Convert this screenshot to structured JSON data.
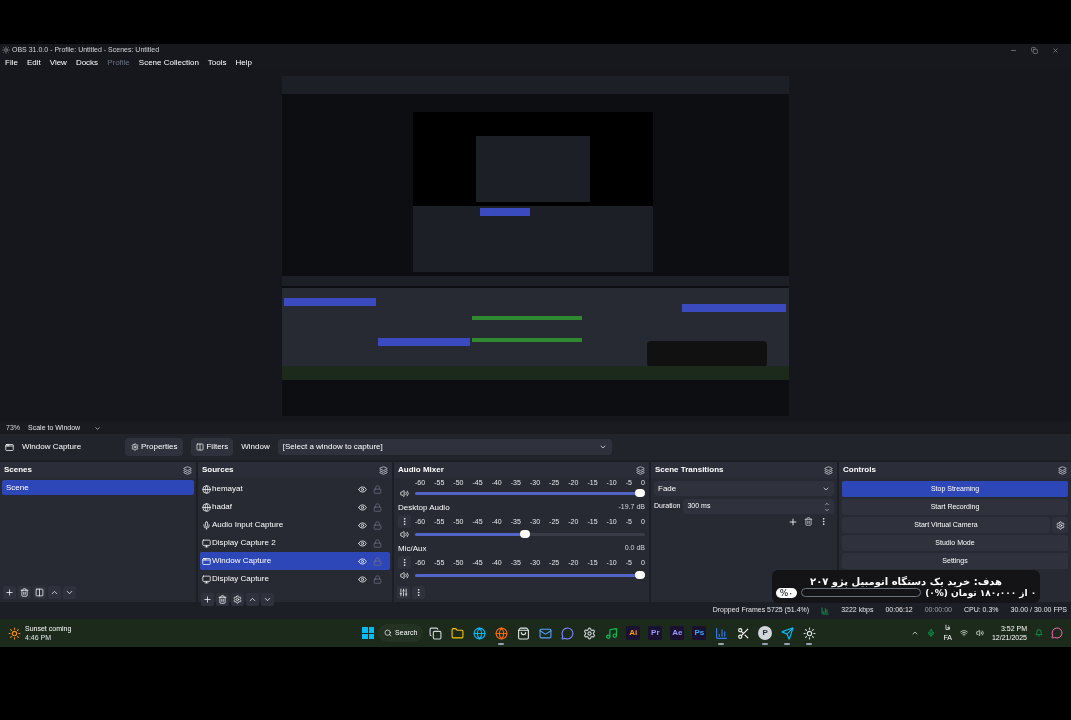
{
  "window": {
    "title": "OBS 31.0.0 - Profile: Untitled - Scenes: Untitled"
  },
  "menu": [
    {
      "label": "File",
      "disabled": false
    },
    {
      "label": "Edit",
      "disabled": false
    },
    {
      "label": "View",
      "disabled": false
    },
    {
      "label": "Docks",
      "disabled": false
    },
    {
      "label": "Profile",
      "disabled": true
    },
    {
      "label": "Scene Collection",
      "disabled": false
    },
    {
      "label": "Tools",
      "disabled": false
    },
    {
      "label": "Help",
      "disabled": false
    }
  ],
  "preview": {
    "zoom": "73%",
    "scale_mode": "Scale to Window"
  },
  "source_toolbar": {
    "source": "Window Capture",
    "properties": "Properties",
    "filters": "Filters",
    "window_label": "Window",
    "window_value": "[Select a window to capture]"
  },
  "scenes": {
    "title": "Scenes",
    "items": [
      {
        "label": "Scene",
        "selected": true
      }
    ]
  },
  "sources": {
    "title": "Sources",
    "items": [
      {
        "label": "hemayat",
        "kind": "browser",
        "selected": false,
        "visible": true,
        "locked": false
      },
      {
        "label": "hadaf",
        "kind": "browser",
        "selected": false,
        "visible": true,
        "locked": false
      },
      {
        "label": "Audio Input Capture",
        "kind": "mic",
        "selected": false,
        "visible": true,
        "locked": false
      },
      {
        "label": "Display Capture 2",
        "kind": "display",
        "selected": false,
        "visible": true,
        "locked": false
      },
      {
        "label": "Window Capture",
        "kind": "window",
        "selected": true,
        "visible": true,
        "locked": false
      },
      {
        "label": "Display Capture",
        "kind": "display",
        "selected": false,
        "visible": true,
        "locked": false
      }
    ]
  },
  "audio_mixer": {
    "title": "Audio Mixer",
    "channels": [
      {
        "ticks": [
          "-60",
          "-55",
          "-50",
          "-45",
          "-40",
          "-35",
          "-30",
          "-25",
          "-20",
          "-15",
          "-10",
          "-5",
          "0"
        ],
        "level": 1
      },
      {
        "name": "Desktop Audio",
        "reading": "-19.7 dB",
        "ticks": [
          "-60",
          "-55",
          "-50",
          "-45",
          "-40",
          "-35",
          "-30",
          "-25",
          "-20",
          "-15",
          "-10",
          "-5",
          "0"
        ],
        "level": 0.5
      },
      {
        "name": "Mic/Aux",
        "reading": "0.0 dB",
        "ticks": [
          "-60",
          "-55",
          "-50",
          "-45",
          "-40",
          "-35",
          "-30",
          "-25",
          "-20",
          "-15",
          "-10",
          "-5",
          "0"
        ],
        "level": 1
      }
    ]
  },
  "scene_transitions": {
    "title": "Scene Transitions",
    "transition": "Fade",
    "duration_label": "Duration",
    "duration": "300 ms"
  },
  "controls": {
    "title": "Controls",
    "buttons": [
      {
        "label": "Stop Streaming",
        "active": true,
        "kind": "plain"
      },
      {
        "label": "Start Recording",
        "active": false,
        "kind": "plain"
      },
      {
        "label": "Start Virtual Camera",
        "active": false,
        "kind": "with-settings"
      },
      {
        "label": "Studio Mode",
        "active": false,
        "kind": "plain"
      },
      {
        "label": "Settings",
        "active": false,
        "kind": "plain"
      }
    ]
  },
  "status_bar": {
    "dropped_frames": "Dropped Frames 5725 (51.4%)",
    "bitrate": "3222 kbps",
    "stream_time": "00:06:12",
    "record_time": "00:00:00",
    "cpu": "CPU: 0.3%",
    "fps": "30.00 / 30.00 FPS"
  },
  "goal_overlay": {
    "title": "هدف: خرید یک دستگاه اتومبیل پژو ۲۰۷",
    "badge": "%۰",
    "level": 0,
    "caption": "۰ از ۱۸۰،۰۰۰ تومان (%۰)"
  },
  "taskbar": {
    "weather": {
      "title": "Sunset coming",
      "subtitle": "4:46 PM"
    },
    "search": "Search",
    "apps": [
      {
        "kind": "task-view",
        "running": false
      },
      {
        "kind": "folder",
        "running": false
      },
      {
        "kind": "edge",
        "running": false
      },
      {
        "kind": "firefox",
        "running": true
      },
      {
        "kind": "store",
        "running": false
      },
      {
        "kind": "outlook",
        "running": false
      },
      {
        "kind": "discord",
        "running": false
      },
      {
        "kind": "settings",
        "running": false
      },
      {
        "kind": "spotify",
        "running": false
      },
      {
        "kind": "tile",
        "label": "Ai",
        "color": "#ff9a00",
        "running": false
      },
      {
        "kind": "tile",
        "label": "Pr",
        "color": "#9999ff",
        "running": false
      },
      {
        "kind": "tile",
        "label": "Ae",
        "color": "#9999ff",
        "running": false
      },
      {
        "kind": "tile",
        "label": "Ps",
        "color": "#31a8ff",
        "running": false
      },
      {
        "kind": "chart",
        "running": true
      },
      {
        "kind": "capcut",
        "running": false
      },
      {
        "kind": "letter",
        "label": "P",
        "running": true
      },
      {
        "kind": "telegram",
        "running": true
      },
      {
        "kind": "obs",
        "running": true
      }
    ],
    "tray": {
      "language_top": "فا",
      "language": "FA",
      "time": "3:52 PM",
      "date": "12/21/2025"
    }
  }
}
